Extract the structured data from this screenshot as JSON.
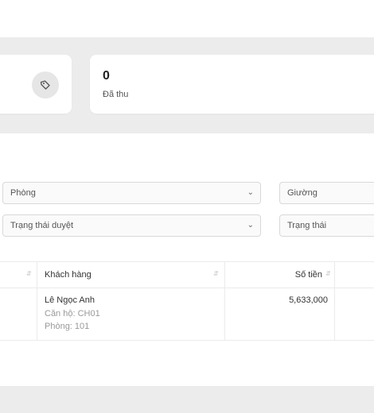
{
  "stats": {
    "collected_value": "0",
    "collected_label": "Đã thu",
    "icon": "tag-icon"
  },
  "filters": {
    "room": "Phòng",
    "bed": "Giường",
    "approval_status": "Trạng thái duyệt",
    "status": "Trạng thái"
  },
  "table": {
    "columns": {
      "customer": "Khách hàng",
      "amount": "Số tiền"
    },
    "rows": [
      {
        "customer_name": "Lê Ngọc Anh",
        "apartment": "Căn hộ: CH01",
        "room": "Phòng: 101",
        "amount": "5,633,000"
      }
    ]
  }
}
